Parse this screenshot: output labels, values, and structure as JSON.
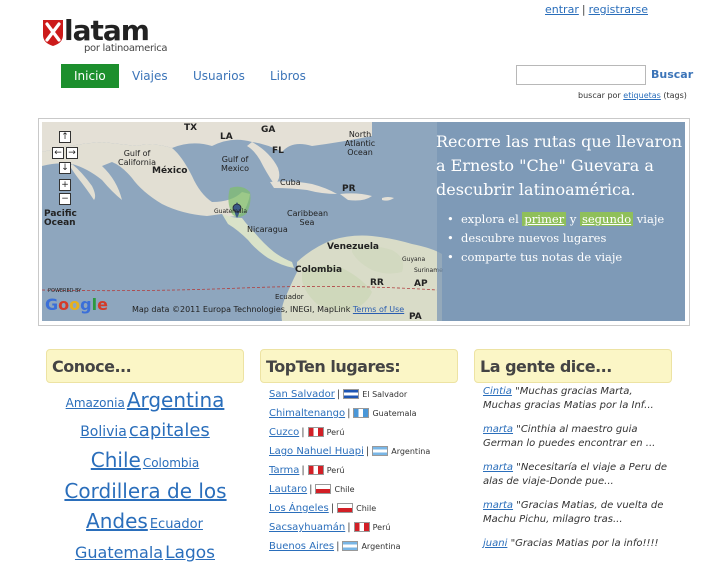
{
  "top_links": {
    "login": "entrar",
    "register": "registrarse"
  },
  "logo": {
    "word": "latam",
    "tagline": "por latinoamerica",
    "colors": {
      "shield": "#cc1b1b",
      "text": "#222222"
    }
  },
  "nav": {
    "items": [
      {
        "label": "Inicio",
        "active": true
      },
      {
        "label": "Viajes",
        "active": false
      },
      {
        "label": "Usuarios",
        "active": false
      },
      {
        "label": "Libros",
        "active": false
      }
    ]
  },
  "search": {
    "value": "",
    "button": "Buscar",
    "hint_prefix": "buscar por",
    "hint_link": "etiquetas",
    "hint_suffix": "(tags)"
  },
  "map": {
    "labels": [
      "TX",
      "LA",
      "GA",
      "FL",
      "North Atlantic Ocean",
      "Gulf of California",
      "México",
      "Gulf of Mexico",
      "Cuba",
      "PR",
      "Caribbean Sea",
      "Nicaragua",
      "Guatemala",
      "Pacific Ocean",
      "Venezuela",
      "Guyana",
      "Suriname",
      "RR",
      "AP",
      "Colombia",
      "Ecuador",
      "PA"
    ],
    "attribution": "Map data ©2011 Europa Technologies, INEGI, MapLink",
    "terms": "Terms of Use",
    "powered": "POWERED BY",
    "google": "Google",
    "controls": {
      "up": "↑",
      "left": "←",
      "right": "→",
      "down": "↓",
      "zoom_in": "+",
      "zoom_out": "−"
    },
    "overlay": {
      "headline": "Recorre las rutas que llevaron a Ernesto \"Che\" Guevara a descubrir latinoamérica.",
      "bullets": {
        "explore_prefix": "explora el",
        "first": "primer",
        "and": "y",
        "second": "segundo",
        "explore_suffix": "viaje",
        "discover": "descubre nuevos lugares",
        "share": "comparte tus notas de viaje"
      }
    }
  },
  "sections": {
    "conoce": {
      "title": "Conoce..."
    },
    "topten": {
      "title": "TopTen lugares:"
    },
    "gente": {
      "title": "La gente dice..."
    }
  },
  "tag_cloud": [
    {
      "text": "Amazonia",
      "size": 12
    },
    {
      "text": "Argentina",
      "size": 20
    },
    {
      "text": "Bolivia",
      "size": 14
    },
    {
      "text": "capitales",
      "size": 18
    },
    {
      "text": "Chile",
      "size": 20
    },
    {
      "text": "Colombia",
      "size": 12
    },
    {
      "text": "Cordillera de los Andes",
      "size": 20
    },
    {
      "text": "Ecuador",
      "size": 13
    },
    {
      "text": "Guatemala",
      "size": 16
    },
    {
      "text": "Lagos",
      "size": 17
    }
  ],
  "top_places": [
    {
      "name": "San Salvador",
      "country": "El Salvador",
      "flag": "sv"
    },
    {
      "name": "Chimaltenango",
      "country": "Guatemala",
      "flag": "gt"
    },
    {
      "name": "Cuzco",
      "country": "Perú",
      "flag": "pe"
    },
    {
      "name": "Lago Nahuel Huapi",
      "country": "Argentina",
      "flag": "ar"
    },
    {
      "name": "Tarma",
      "country": "Perú",
      "flag": "pe"
    },
    {
      "name": "Lautaro",
      "country": "Chile",
      "flag": "cl"
    },
    {
      "name": "Los Ángeles",
      "country": "Chile",
      "flag": "cl"
    },
    {
      "name": "Sacsayhuamán",
      "country": "Perú",
      "flag": "pe"
    },
    {
      "name": "Buenos Aires",
      "country": "Argentina",
      "flag": "ar"
    }
  ],
  "comments": [
    {
      "user": "Cintia",
      "text": "\"Muchas gracias Marta, Muchas gracias Matias por la Inf..."
    },
    {
      "user": "marta",
      "text": "\"Cinthia al maestro guia German lo puedes encontrar en ..."
    },
    {
      "user": "marta",
      "text": "\"Necesitaría el viaje a Peru de alas de viaje-Donde pue..."
    },
    {
      "user": "marta",
      "text": "\"Gracias Matias, de vuelta de Machu Pichu, milagro tras..."
    },
    {
      "user": "juani",
      "text": "\"Gracias Matias por la info!!!!"
    }
  ],
  "colors": {
    "nav_active": "#1c8f2d",
    "link": "#2a6ebb",
    "section_bg": "#fbf6c6",
    "map_overlay": "#7896b4",
    "highlight": "#8fbf5a"
  }
}
